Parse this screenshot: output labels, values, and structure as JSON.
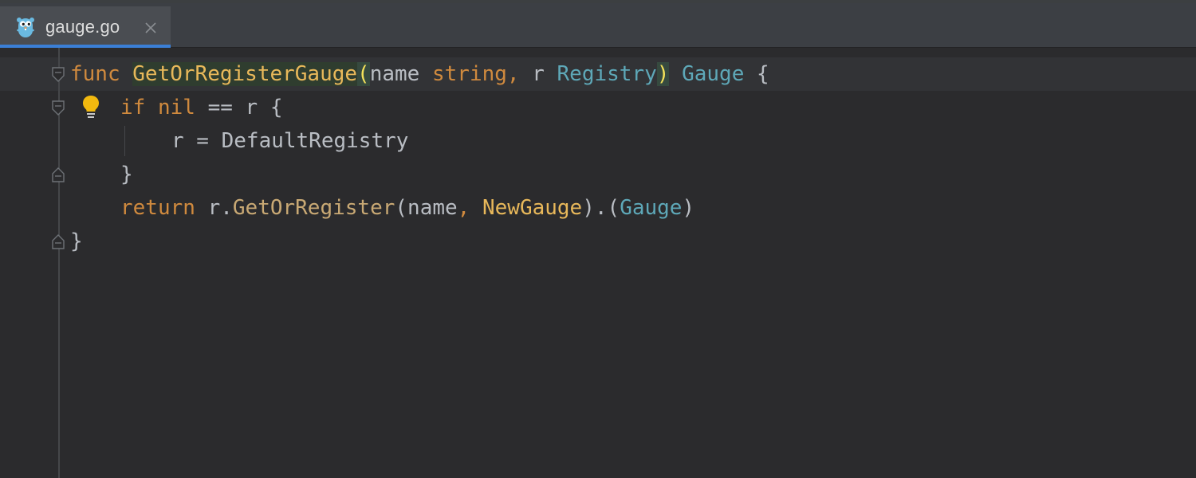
{
  "tab": {
    "filename": "gauge.go",
    "file_icon": "gopher-icon",
    "close_icon": "close-icon"
  },
  "code": {
    "line1": {
      "kw_func": "func ",
      "func_name": "GetOrRegisterGauge",
      "open_paren": "(",
      "p1_name": "name ",
      "p1_type": "string",
      "comma": ", ",
      "p2_name": "r ",
      "p2_type": "Registry",
      "close_paren": ")",
      "space": " ",
      "ret_type": "Gauge",
      "brace": " {"
    },
    "line2": {
      "kw_if": "if ",
      "kw_nil": "nil",
      "rest": " == r {"
    },
    "line3": {
      "text": "r = DefaultRegistry"
    },
    "line4": {
      "text": "}"
    },
    "line5": {
      "kw_return": "return ",
      "recv": "r.",
      "method": "GetOrRegister",
      "args_open": "(name",
      "comma": ", ",
      "arg2": "NewGauge",
      "assert_open": ").(",
      "assert_type": "Gauge",
      "assert_close": ")"
    },
    "line6": {
      "text": "}"
    }
  },
  "icons": {
    "intention": "lightbulb-icon",
    "fold_open": "fold-open-icon",
    "fold_close": "fold-close-icon"
  },
  "colors": {
    "background": "#2b2b2d",
    "keyword": "#d08a3e",
    "function": "#e8b85a",
    "type": "#5ea8b8",
    "identifier": "#b9bdc3",
    "tab_accent": "#3b7fd6",
    "bulb": "#f2b90f"
  }
}
